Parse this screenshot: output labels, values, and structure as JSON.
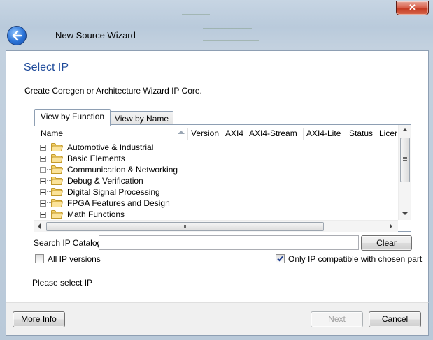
{
  "window": {
    "title": "New Source Wizard",
    "close_label": "✕"
  },
  "page": {
    "heading": "Select IP",
    "description": "Create Coregen or Architecture Wizard IP Core."
  },
  "tabs": [
    {
      "label": "View by Function",
      "active": true
    },
    {
      "label": "View by Name",
      "active": false
    }
  ],
  "table": {
    "columns": [
      "Name",
      "Version",
      "AXI4",
      "AXI4-Stream",
      "AXI4-Lite",
      "Status",
      "Licer"
    ],
    "rows": [
      {
        "label": "Automotive & Industrial",
        "icon": "folder-icon"
      },
      {
        "label": "Basic Elements",
        "icon": "folder-icon"
      },
      {
        "label": "Communication & Networking",
        "icon": "folder-icon"
      },
      {
        "label": "Debug & Verification",
        "icon": "folder-icon"
      },
      {
        "label": "Digital Signal Processing",
        "icon": "folder-icon"
      },
      {
        "label": "FPGA Features and Design",
        "icon": "folder-icon"
      },
      {
        "label": "Math Functions",
        "icon": "folder-icon"
      }
    ]
  },
  "search": {
    "label": "Search IP Catalog:",
    "value": "",
    "clear_label": "Clear"
  },
  "options": {
    "all_versions_label": "All IP versions",
    "all_versions_checked": false,
    "compatible_label": "Only IP compatible with chosen part",
    "compatible_checked": true
  },
  "status_text": "Please select IP",
  "footer": {
    "more_info_label": "More Info",
    "next_label": "Next",
    "cancel_label": "Cancel"
  },
  "colors": {
    "heading": "#1e4a9a",
    "close_button": "#c43a22",
    "folder": "#f6d36b"
  }
}
